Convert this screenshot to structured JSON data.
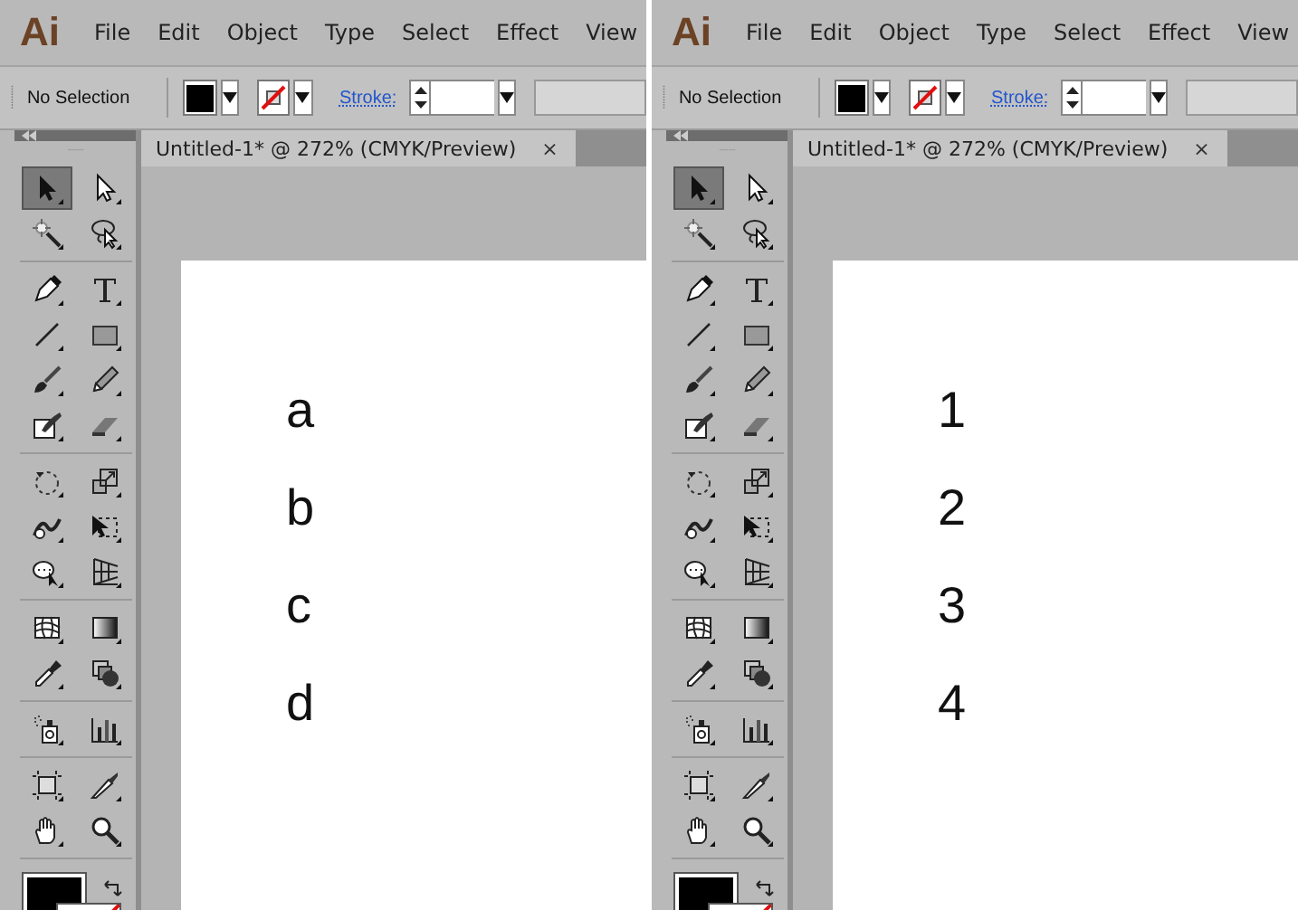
{
  "panels": [
    {
      "logo": "Ai",
      "menu": [
        "File",
        "Edit",
        "Object",
        "Type",
        "Select",
        "Effect",
        "View"
      ],
      "control_bar": {
        "selection_label": "No Selection",
        "stroke_label": "Stroke:"
      },
      "document_tab": {
        "title": "Untitled-1* @ 272% (CMYK/Preview)",
        "close": "×"
      },
      "tool_groups": [
        [
          {
            "kind": "selection",
            "selected": true
          },
          {
            "kind": "direct",
            "selected": false
          },
          {
            "kind": "wand",
            "selected": false
          },
          {
            "kind": "lasso",
            "selected": false
          }
        ],
        [
          {
            "kind": "pen",
            "selected": false
          },
          {
            "kind": "type",
            "selected": false
          },
          {
            "kind": "line",
            "selected": false
          },
          {
            "kind": "rect",
            "selected": false
          },
          {
            "kind": "brush",
            "selected": false
          },
          {
            "kind": "pencil",
            "selected": false
          },
          {
            "kind": "blob",
            "selected": false
          },
          {
            "kind": "eraser",
            "selected": false
          }
        ],
        [
          {
            "kind": "rotate",
            "selected": false
          },
          {
            "kind": "scale",
            "selected": false
          },
          {
            "kind": "warp",
            "selected": false
          },
          {
            "kind": "free",
            "selected": false
          },
          {
            "kind": "builder",
            "selected": false
          },
          {
            "kind": "perspective",
            "selected": false
          }
        ],
        [
          {
            "kind": "mesh",
            "selected": false
          },
          {
            "kind": "gradient",
            "selected": false
          },
          {
            "kind": "eyedropper",
            "selected": false
          },
          {
            "kind": "blend",
            "selected": false
          }
        ],
        [
          {
            "kind": "sprayer",
            "selected": false
          },
          {
            "kind": "graph",
            "selected": false
          }
        ],
        [
          {
            "kind": "artboard",
            "selected": false
          },
          {
            "kind": "slice",
            "selected": false
          },
          {
            "kind": "hand",
            "selected": false
          },
          {
            "kind": "zoom",
            "selected": false
          }
        ]
      ],
      "artboard_text": [
        "a",
        "b",
        "c",
        "d"
      ]
    },
    {
      "logo": "Ai",
      "menu": [
        "File",
        "Edit",
        "Object",
        "Type",
        "Select",
        "Effect",
        "View"
      ],
      "control_bar": {
        "selection_label": "No Selection",
        "stroke_label": "Stroke:"
      },
      "document_tab": {
        "title": "Untitled-1* @ 272% (CMYK/Preview)",
        "close": "×"
      },
      "tool_groups": [
        [
          {
            "kind": "selection",
            "selected": true
          },
          {
            "kind": "direct",
            "selected": false
          },
          {
            "kind": "wand",
            "selected": false
          },
          {
            "kind": "lasso",
            "selected": false
          }
        ],
        [
          {
            "kind": "pen",
            "selected": false
          },
          {
            "kind": "type",
            "selected": false
          },
          {
            "kind": "line",
            "selected": false
          },
          {
            "kind": "rect",
            "selected": false
          },
          {
            "kind": "brush",
            "selected": false
          },
          {
            "kind": "pencil",
            "selected": false
          },
          {
            "kind": "blob",
            "selected": false
          },
          {
            "kind": "eraser",
            "selected": false
          }
        ],
        [
          {
            "kind": "rotate",
            "selected": false
          },
          {
            "kind": "scale",
            "selected": false
          },
          {
            "kind": "warp",
            "selected": false
          },
          {
            "kind": "free",
            "selected": false
          },
          {
            "kind": "builder",
            "selected": false
          },
          {
            "kind": "perspective",
            "selected": false
          }
        ],
        [
          {
            "kind": "mesh",
            "selected": false
          },
          {
            "kind": "gradient",
            "selected": false
          },
          {
            "kind": "eyedropper",
            "selected": false
          },
          {
            "kind": "blend",
            "selected": false
          }
        ],
        [
          {
            "kind": "sprayer",
            "selected": false
          },
          {
            "kind": "graph",
            "selected": false
          }
        ],
        [
          {
            "kind": "artboard",
            "selected": false
          },
          {
            "kind": "slice",
            "selected": false
          },
          {
            "kind": "hand",
            "selected": false
          },
          {
            "kind": "zoom",
            "selected": false
          }
        ]
      ],
      "artboard_text": [
        "1",
        "2",
        "3",
        "4"
      ]
    }
  ]
}
